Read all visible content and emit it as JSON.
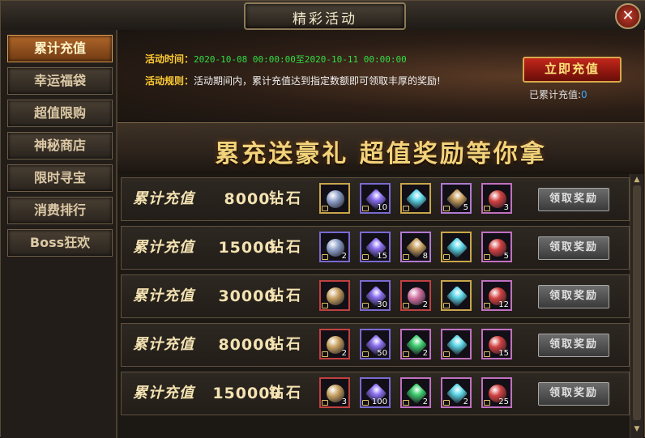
{
  "window": {
    "title": "精彩活动",
    "close_label": "✕"
  },
  "sidebar": {
    "items": [
      {
        "label": "累计充值",
        "active": true
      },
      {
        "label": "幸运福袋"
      },
      {
        "label": "超值限购"
      },
      {
        "label": "神秘商店"
      },
      {
        "label": "限时寻宝"
      },
      {
        "label": "消费排行"
      },
      {
        "label": "Boss狂欢"
      }
    ]
  },
  "banner": {
    "time_label": "活动时间：",
    "time_start": "2020-10-08 00:00:00",
    "time_sep": "至",
    "time_end": "2020-10-11 00:00:00",
    "rule_label": "活动规则：",
    "rule_text": "活动期间内，累计充值达到指定数额即可领取丰厚的奖励!",
    "recharge_button": "立即充值",
    "total_label": "已累计充值:",
    "total_value": "0"
  },
  "slogan": "累充送豪礼  超值奖励等你拿",
  "rewards": {
    "row_label": "累计充值",
    "unit": "钻石",
    "claim_label": "领取奖励",
    "rows": [
      {
        "amount": "8000",
        "items": [
          {
            "icon": "silver-medal-icon",
            "count": "",
            "border": "#c9a64a",
            "color": "#8fa0c8"
          },
          {
            "icon": "feather-icon",
            "count": "10",
            "border": "#7a6ad0",
            "color": "#8a6ff0"
          },
          {
            "icon": "diamond-icon",
            "count": "",
            "border": "#c9a64a",
            "color": "#5fd8e8"
          },
          {
            "icon": "scroll-icon",
            "count": "5",
            "border": "#b07ad0",
            "color": "#c8a060"
          },
          {
            "icon": "gem-ring-icon",
            "count": "3",
            "border": "#c070c0",
            "color": "#d04040"
          }
        ]
      },
      {
        "amount": "15000",
        "items": [
          {
            "icon": "silver-medal-icon",
            "count": "2",
            "border": "#7a6ad0",
            "color": "#8fa0c8"
          },
          {
            "icon": "feather-icon",
            "count": "15",
            "border": "#7a6ad0",
            "color": "#8a6ff0"
          },
          {
            "icon": "scroll-icon",
            "count": "8",
            "border": "#b07ad0",
            "color": "#c8a060"
          },
          {
            "icon": "diamond-icon",
            "count": "",
            "border": "#c9a64a",
            "color": "#5fd8e8"
          },
          {
            "icon": "gem-ring-icon",
            "count": "5",
            "border": "#c070c0",
            "color": "#d04040"
          }
        ]
      },
      {
        "amount": "30000",
        "items": [
          {
            "icon": "gold-medal-icon",
            "count": "",
            "border": "#c04040",
            "color": "#c8a060"
          },
          {
            "icon": "feather-icon",
            "count": "30",
            "border": "#7a6ad0",
            "color": "#8a6ff0"
          },
          {
            "icon": "rainbow-orb-icon",
            "count": "2",
            "border": "#c04040",
            "color": "#d070a0"
          },
          {
            "icon": "diamond-icon",
            "count": "",
            "border": "#c9a64a",
            "color": "#5fd8e8"
          },
          {
            "icon": "gem-ring-icon",
            "count": "12",
            "border": "#c070c0",
            "color": "#d04040"
          }
        ]
      },
      {
        "amount": "80000",
        "items": [
          {
            "icon": "gold-medal-icon",
            "count": "2",
            "border": "#c04040",
            "color": "#c8a060"
          },
          {
            "icon": "feather-icon",
            "count": "50",
            "border": "#7a6ad0",
            "color": "#8a6ff0"
          },
          {
            "icon": "green-crystal-icon",
            "count": "2",
            "border": "#c070c0",
            "color": "#40d070"
          },
          {
            "icon": "diamond-icon",
            "count": "",
            "border": "#c070c0",
            "color": "#5fd8e8"
          },
          {
            "icon": "gem-ring-icon",
            "count": "15",
            "border": "#c070c0",
            "color": "#d04040"
          }
        ]
      },
      {
        "amount": "150000",
        "items": [
          {
            "icon": "gold-medal-icon",
            "count": "3",
            "border": "#c04040",
            "color": "#c8a060"
          },
          {
            "icon": "feather-icon",
            "count": "100",
            "border": "#7a6ad0",
            "color": "#8a6ff0"
          },
          {
            "icon": "green-crystal-icon",
            "count": "2",
            "border": "#c070c0",
            "color": "#40d070"
          },
          {
            "icon": "diamond-icon",
            "count": "2",
            "border": "#c070c0",
            "color": "#5fd8e8"
          },
          {
            "icon": "gem-ring-icon",
            "count": "25",
            "border": "#c070c0",
            "color": "#d04040"
          }
        ]
      }
    ]
  }
}
